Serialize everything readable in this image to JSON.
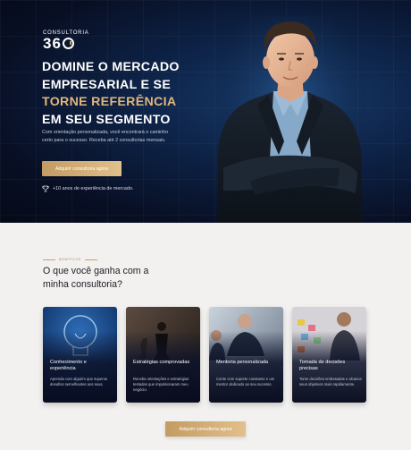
{
  "logo": {
    "top_text": "CONSULTORIA",
    "main_text": "36"
  },
  "hero": {
    "headline_line1": "DOMINE O MERCADO",
    "headline_line2": "EMPRESARIAL E SE",
    "headline_gold": "TORNE REFERÊNCIA",
    "headline_line4": "EM SEU SEGMENTO",
    "description": "Com orientação personalizada, você encontrará o caminho certo para o sucesso. Receba até 2 consultorias mensais.",
    "cta_label": "Adquirir consultoria agora",
    "award_text": "+10 anos de experiência de mercado.",
    "accent_color": "#e1b77c"
  },
  "benefits": {
    "eyebrow": "BENEFÍCIOS",
    "title": "O que você ganha com a minha consultoria?",
    "cards": [
      {
        "title": "Conhecimento e experiência",
        "description": "Aprenda com alguém que superou desafios semelhantes aos seus."
      },
      {
        "title": "Estratégias comprovadas",
        "description": "Receba orientações e estratégias testadas que impulsionaram meu negócio."
      },
      {
        "title": "Mentoria personalizada",
        "description": "Conte com suporte constante e um mentor dedicado ao seu sucesso."
      },
      {
        "title": "Tomada de decisões precisas",
        "description": "Tome decisões embasadas e alcance seus objetivos mais rapidamente."
      }
    ],
    "cta_label": "Adquirir consultoria agora"
  }
}
